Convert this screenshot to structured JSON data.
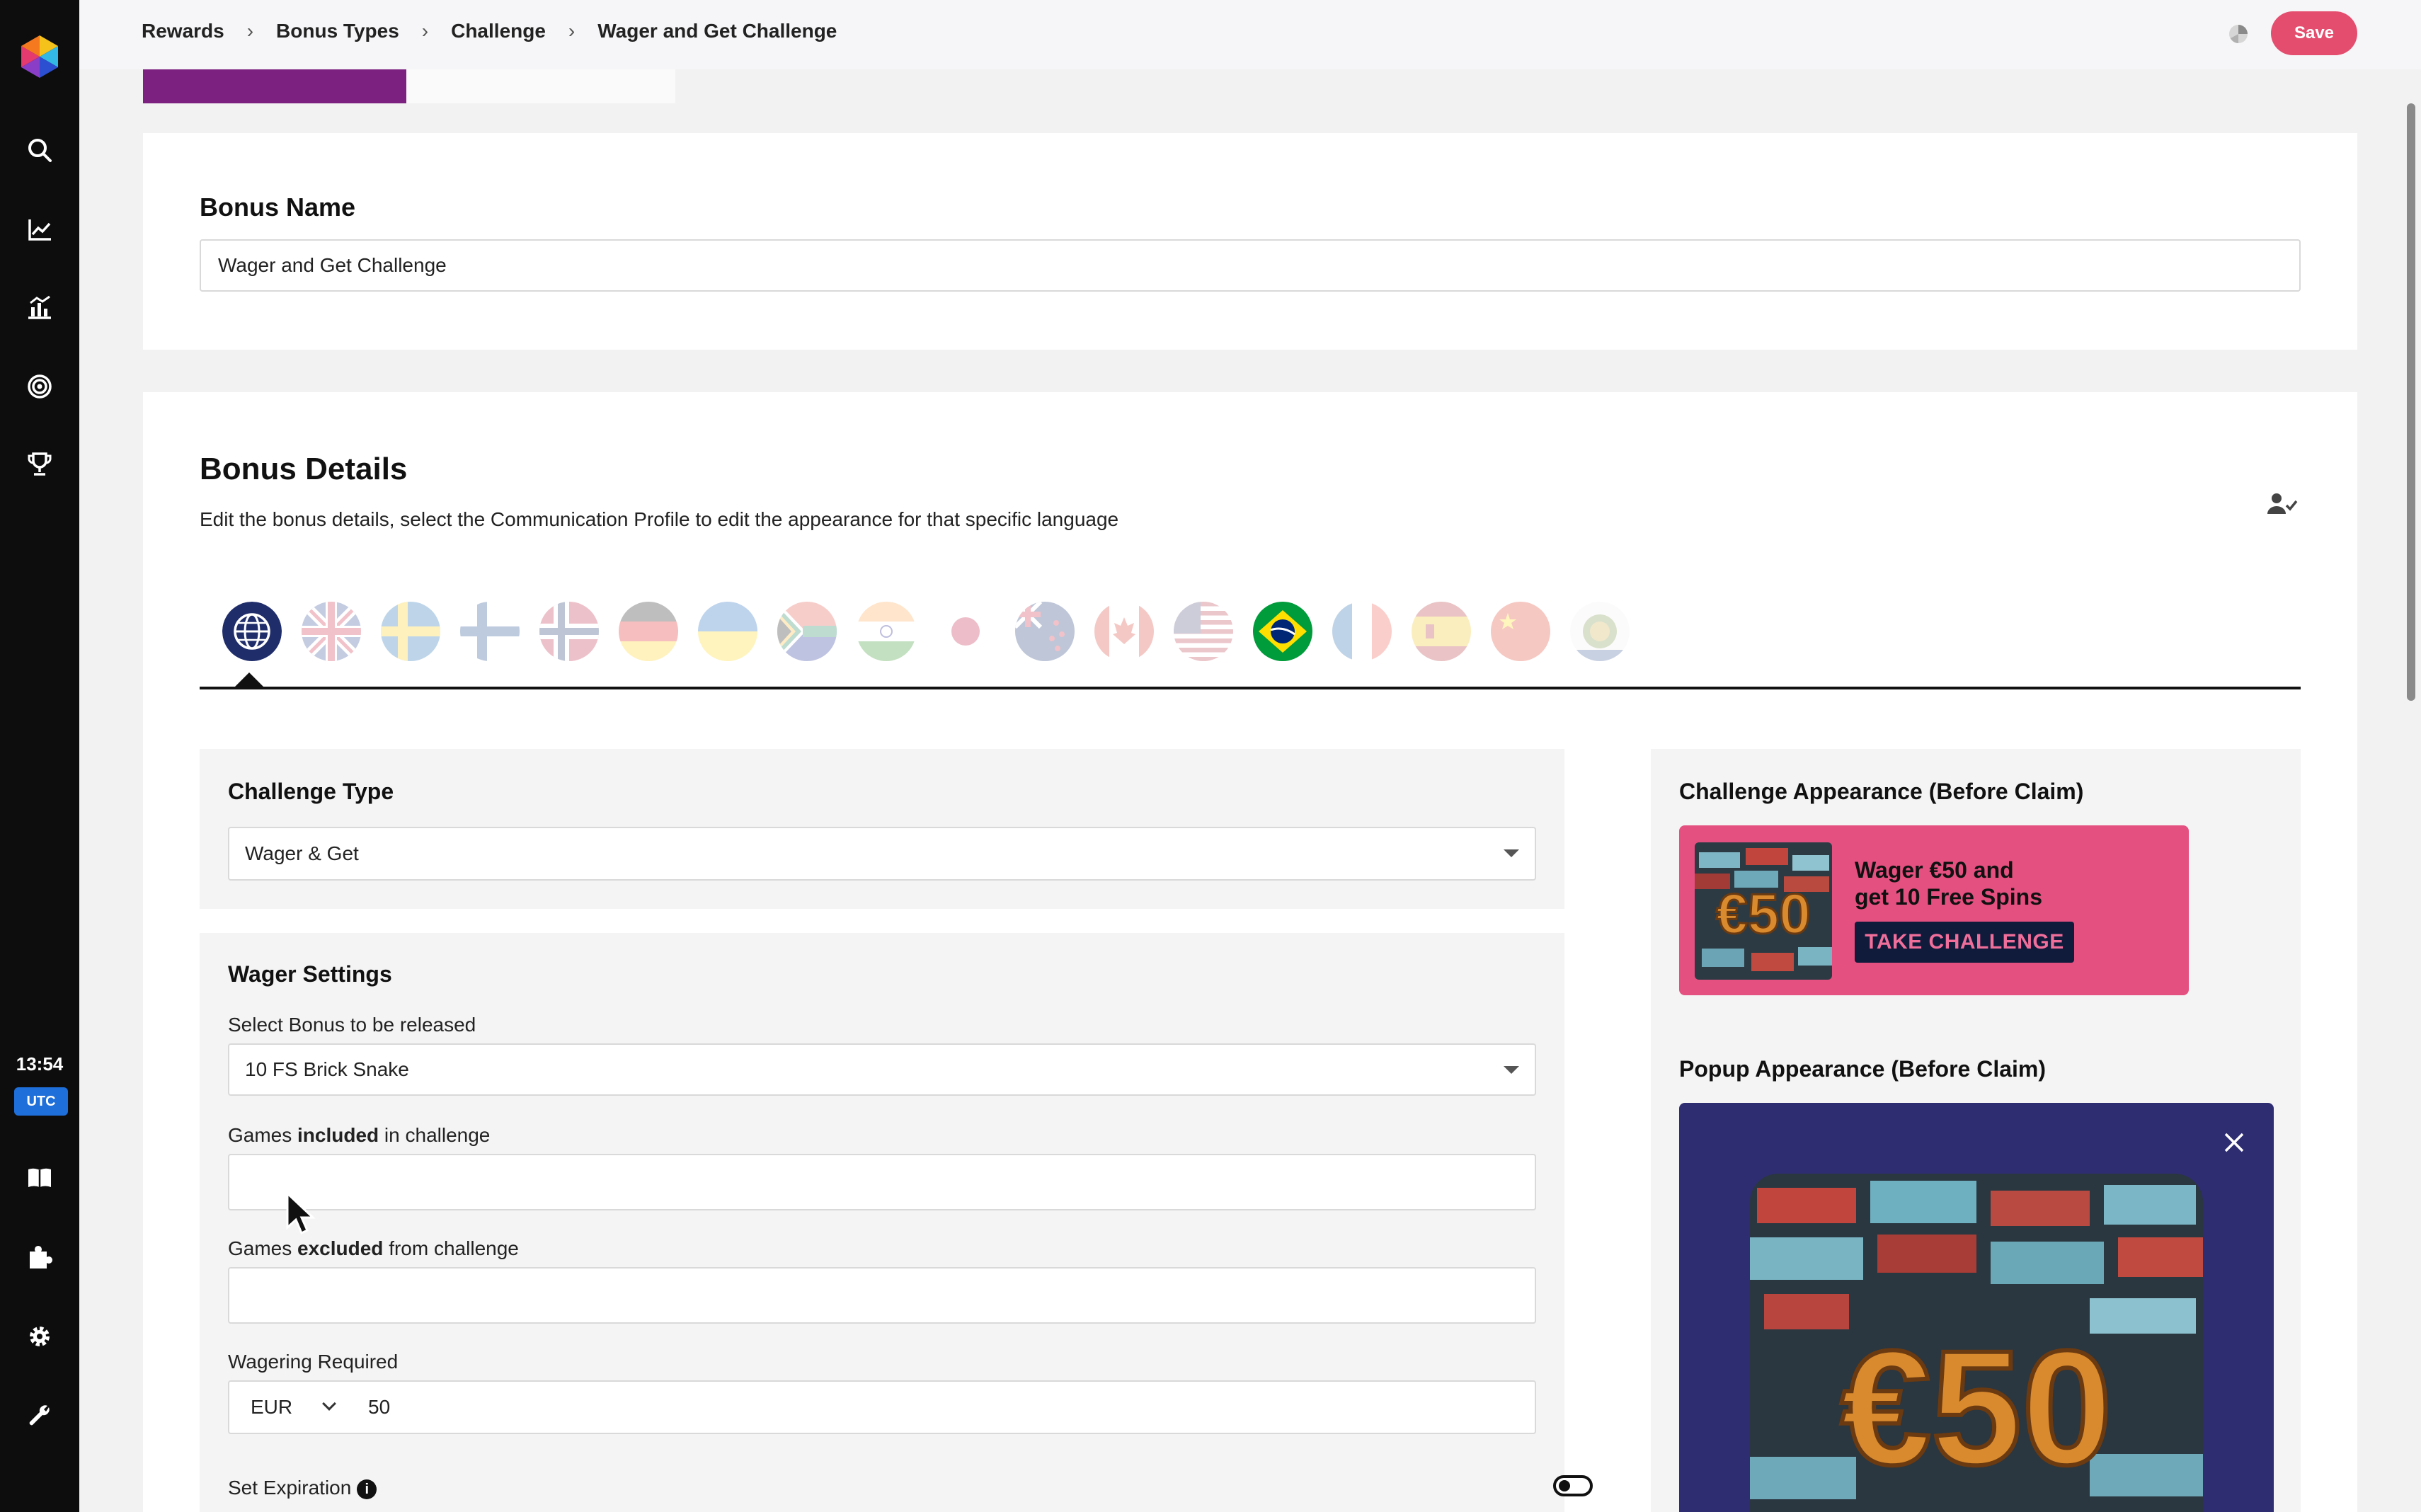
{
  "sidebar": {
    "clock": "13:54",
    "timezone": "UTC",
    "icons": [
      "logo-icon",
      "search-icon",
      "trend-chart-icon",
      "bar-chart-icon",
      "target-icon",
      "trophy-icon",
      "book-icon",
      "puzzle-icon",
      "gear-icon",
      "wrench-icon"
    ]
  },
  "header": {
    "breadcrumb": [
      "Rewards",
      "Bonus Types",
      "Challenge",
      "Wager and Get Challenge"
    ],
    "save_label": "Save"
  },
  "bonus_name": {
    "heading": "Bonus Name",
    "value": "Wager and Get Challenge"
  },
  "bonus_details": {
    "heading": "Bonus Details",
    "description": "Edit the bonus details, select the Communication Profile to edit the appearance for that specific language",
    "languages": [
      "globe",
      "uk",
      "sweden",
      "finland",
      "norway",
      "germany",
      "ukraine",
      "south-africa",
      "india",
      "japan",
      "new-zealand",
      "canada",
      "usa",
      "brazil",
      "france",
      "spain",
      "china",
      "other"
    ],
    "selected_language": "globe"
  },
  "challenge_type": {
    "heading": "Challenge Type",
    "value": "Wager & Get"
  },
  "wager_settings": {
    "heading": "Wager Settings",
    "bonus_label": "Select Bonus to be released",
    "bonus_value": "10 FS Brick Snake",
    "included_prefix": "Games ",
    "included_bold": "included",
    "included_suffix": " in challenge",
    "excluded_prefix": "Games ",
    "excluded_bold": "excluded",
    "excluded_suffix": " from challenge",
    "wagering_label": "Wagering Required",
    "currency": "EUR",
    "wagering_value": "50",
    "expiration_label": "Set Expiration",
    "info_glyph": "i",
    "expiration_enabled": false
  },
  "appearance": {
    "challenge_heading": "Challenge Appearance (Before Claim)",
    "banner_line1": "Wager €50 and",
    "banner_line2": "get 10 Free Spins",
    "banner_button": "TAKE CHALLENGE",
    "banner_image_text": "€50",
    "popup_heading": "Popup Appearance (Before Claim)",
    "popup_image_text": "€50"
  },
  "colors": {
    "accent": "#e44d6e",
    "tab_active": "#7d2180",
    "banner_bg": "#e45080",
    "popup_bg": "#2e2d72",
    "utc_badge": "#1e6fd9"
  }
}
